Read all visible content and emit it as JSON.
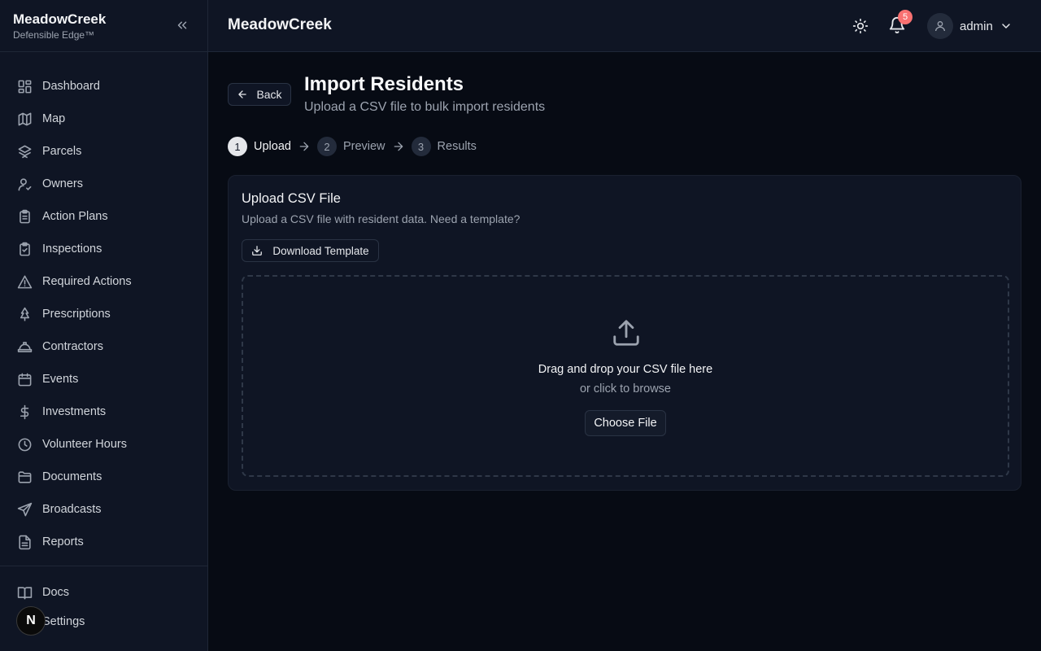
{
  "brand": {
    "name": "MeadowCreek",
    "tagline": "Defensible Edge™"
  },
  "sidebar": {
    "items": [
      {
        "label": "Dashboard",
        "icon": "dashboard-icon"
      },
      {
        "label": "Map",
        "icon": "map-icon"
      },
      {
        "label": "Parcels",
        "icon": "layers-icon"
      },
      {
        "label": "Owners",
        "icon": "user-check-icon"
      },
      {
        "label": "Action Plans",
        "icon": "clipboard-list-icon"
      },
      {
        "label": "Inspections",
        "icon": "clipboard-check-icon"
      },
      {
        "label": "Required Actions",
        "icon": "alert-triangle-icon"
      },
      {
        "label": "Prescriptions",
        "icon": "tree-icon"
      },
      {
        "label": "Contractors",
        "icon": "hard-hat-icon"
      },
      {
        "label": "Events",
        "icon": "calendar-icon"
      },
      {
        "label": "Investments",
        "icon": "dollar-icon"
      },
      {
        "label": "Volunteer Hours",
        "icon": "clock-icon"
      },
      {
        "label": "Documents",
        "icon": "folder-icon"
      },
      {
        "label": "Broadcasts",
        "icon": "send-icon"
      },
      {
        "label": "Reports",
        "icon": "file-text-icon"
      }
    ],
    "bottom_items": [
      {
        "label": "Docs",
        "icon": "book-icon"
      },
      {
        "label": "Settings",
        "icon": "gear-icon"
      }
    ],
    "n_badge": "N"
  },
  "header": {
    "title": "MeadowCreek",
    "notification_count": "5",
    "user_name": "admin"
  },
  "page": {
    "back_label": "Back",
    "title": "Import Residents",
    "subtitle": "Upload a CSV file to bulk import residents",
    "steps": [
      {
        "number": "1",
        "label": "Upload",
        "active": true
      },
      {
        "number": "2",
        "label": "Preview",
        "active": false
      },
      {
        "number": "3",
        "label": "Results",
        "active": false
      }
    ]
  },
  "card": {
    "title": "Upload CSV File",
    "description": "Upload a CSV file with resident data. Need a template?",
    "download_label": "Download Template",
    "dropzone_main": "Drag and drop your CSV file here",
    "dropzone_sub": "or click to browse",
    "choose_label": "Choose File"
  },
  "colors": {
    "background": "#070b14",
    "panel": "#0f1524",
    "border": "#1f2737",
    "badge": "#f87171"
  }
}
